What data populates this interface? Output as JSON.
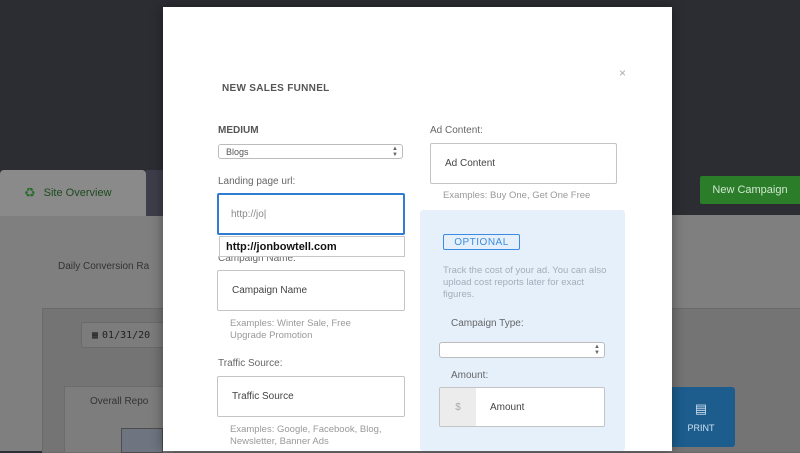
{
  "background": {
    "tab_label": "Site Overview",
    "new_campaign_label": "New Campaign",
    "daily_label": "Daily Conversion Ra",
    "date_value": "01/31/20",
    "card_title": "Overall Repo",
    "print_label": "PRINT"
  },
  "modal": {
    "title": "NEW SALES FUNNEL",
    "close": "×",
    "medium_label": "MEDIUM",
    "medium_value": "Blogs",
    "landing_label": "Landing page url:",
    "landing_value": "http://jo|",
    "autocomplete_value": "http://jonbowtell.com",
    "campaign_label": "Campaign Name:",
    "campaign_placeholder": "Campaign Name",
    "campaign_hint": "Examples: Winter Sale, Free Upgrade Promotion",
    "traffic_label": "Traffic Source:",
    "traffic_placeholder": "Traffic Source",
    "traffic_hint": "Examples: Google, Facebook, Blog, Newsletter, Banner Ads",
    "ad_content_label": "Ad Content:",
    "ad_content_placeholder": "Ad Content",
    "ad_content_hint": "Examples: Buy One, Get One Free",
    "optional_badge": "OPTIONAL",
    "optional_text": "Track the cost of your ad. You can also upload cost reports later for exact figures.",
    "campaign_type_label": "Campaign Type:",
    "campaign_type_value": "",
    "amount_label": "Amount:",
    "amount_prefix": "$",
    "amount_placeholder": "Amount"
  },
  "colors": {
    "accent_blue": "#2f7cd0",
    "optional_bg": "#e5f0fb",
    "green_button": "#2b7d2a",
    "print_button": "#1c5d8e"
  }
}
